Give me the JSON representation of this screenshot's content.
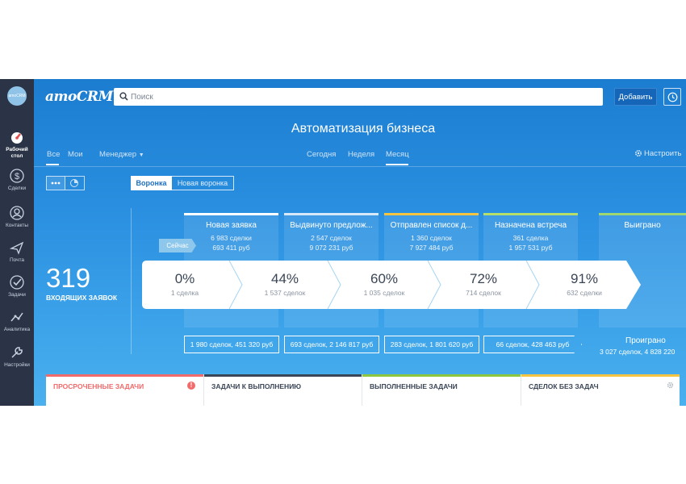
{
  "sidebar": {
    "logo": "amoCRM",
    "items": [
      {
        "label": "Рабочий стол",
        "icon": "dashboard-icon"
      },
      {
        "label": "Сделки",
        "icon": "deals-icon"
      },
      {
        "label": "Контакты",
        "icon": "contacts-icon"
      },
      {
        "label": "Почта",
        "icon": "mail-icon"
      },
      {
        "label": "Задачи",
        "icon": "tasks-icon"
      },
      {
        "label": "Аналитика",
        "icon": "analytics-icon"
      },
      {
        "label": "Настройки",
        "icon": "settings-icon"
      }
    ]
  },
  "header": {
    "brand": "amoCRM.",
    "search_placeholder": "Поиск",
    "add_button": "Добавить",
    "page_title": "Автоматизация бизнеса"
  },
  "filters": {
    "all": "Все",
    "mine": "Мои",
    "manager": "Менеджер",
    "today": "Сегодня",
    "week": "Неделя",
    "month": "Месяц",
    "settings": "Настроить"
  },
  "view": {
    "funnel": "Воронка",
    "new_funnel": "Новая воронка"
  },
  "summary": {
    "incoming_count": "319",
    "incoming_label": "ВХОДЯЩИХ ЗАЯВОК",
    "now_tag": "Сейчас"
  },
  "stages": [
    {
      "name": "Новая заявка",
      "deals": "6 983 сделки",
      "amount": "693 411 руб",
      "color": "#ffffff"
    },
    {
      "name": "Выдвинуто предлож...",
      "deals": "2 547 сделок",
      "amount": "9 072 231 руб",
      "color": "#d7e9f8"
    },
    {
      "name": "Отправлен список д...",
      "deals": "1 360 сделок",
      "amount": "7 927 484 руб",
      "color": "#f5c542"
    },
    {
      "name": "Назначена встреча",
      "deals": "361 сделка",
      "amount": "1 957 531 руб",
      "color": "#b6df6a"
    },
    {
      "name": "Выиграно",
      "deals": "",
      "amount": "",
      "color": "#9ed86f"
    }
  ],
  "conversion": [
    {
      "percent": "0%",
      "count": "1 сделка"
    },
    {
      "percent": "44%",
      "count": "1 537 сделок"
    },
    {
      "percent": "60%",
      "count": "1 035 сделок"
    },
    {
      "percent": "72%",
      "count": "714 сделок"
    },
    {
      "percent": "91%",
      "count": "632 сделки"
    }
  ],
  "totals": [
    "1 980 сделок, 451 320 руб",
    "693 сделок, 2 146 817 руб",
    "283 сделок, 1 801 620 руб",
    "66 сделок, 428 463 руб"
  ],
  "lost": {
    "label": "Проиграно",
    "value": "3 027 сделок, 4 828 220"
  },
  "task_panels": [
    {
      "title": "ПРОСРОЧЕННЫЕ ЗАДАЧИ",
      "color": "#f26b6b"
    },
    {
      "title": "ЗАДАЧИ К ВЫПОЛНЕНИЮ",
      "color": "#3a4556"
    },
    {
      "title": "ВЫПОЛНЕННЫЕ ЗАДАЧИ",
      "color": "#8cc63f"
    },
    {
      "title": "СДЕЛОК БЕЗ ЗАДАЧ",
      "color": "#f5c542"
    }
  ]
}
